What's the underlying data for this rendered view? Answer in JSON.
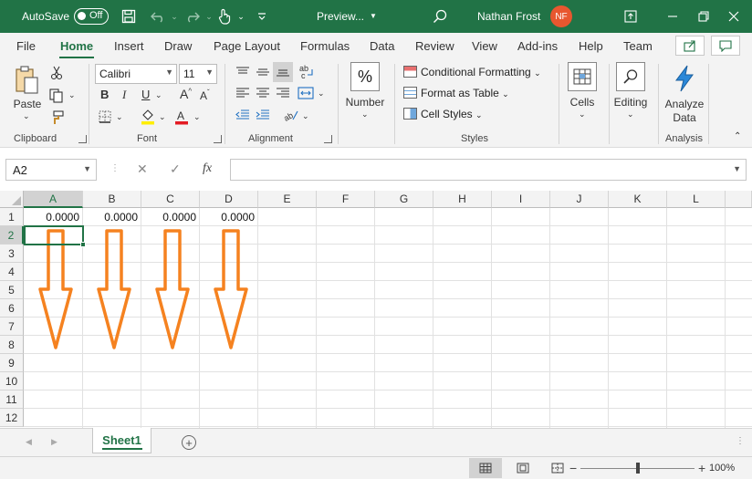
{
  "titlebar": {
    "autosave_label": "AutoSave",
    "autosave_state": "Off",
    "doc_title": "Preview...",
    "user_name": "Nathan Frost",
    "user_initials": "NF",
    "icons": [
      "save-icon",
      "undo-icon",
      "redo-icon",
      "touch-mode-icon",
      "customize-qat-icon",
      "search-icon",
      "ribbon-display-icon",
      "minimize-icon",
      "restore-icon",
      "close-icon"
    ]
  },
  "tabs": [
    "File",
    "Home",
    "Insert",
    "Draw",
    "Page Layout",
    "Formulas",
    "Data",
    "Review",
    "View",
    "Add-ins",
    "Help",
    "Team"
  ],
  "active_tab": "Home",
  "ribbon": {
    "clipboard": {
      "label": "Clipboard",
      "paste_label": "Paste"
    },
    "font": {
      "label": "Font",
      "font_name": "Calibri",
      "font_size": "11",
      "bold": "B",
      "italic": "I",
      "underline": "U"
    },
    "alignment": {
      "label": "Alignment"
    },
    "number": {
      "label": "Number",
      "symbol": "%"
    },
    "styles": {
      "label": "Styles",
      "conditional_formatting": "Conditional Formatting",
      "format_as_table": "Format as Table",
      "cell_styles": "Cell Styles"
    },
    "cells": {
      "label": "Cells"
    },
    "editing": {
      "label": "Editing"
    },
    "analysis": {
      "label": "Analysis",
      "analyze_data": "Analyze Data"
    }
  },
  "formula_bar": {
    "name_box": "A2",
    "fx": "fx",
    "formula": ""
  },
  "grid": {
    "columns": [
      "A",
      "B",
      "C",
      "D",
      "E",
      "F",
      "G",
      "H",
      "I",
      "J",
      "K",
      "L"
    ],
    "rows": [
      "1",
      "2",
      "3",
      "4",
      "5",
      "6",
      "7",
      "8",
      "9",
      "10",
      "11",
      "12"
    ],
    "row1_values": [
      "0.0000",
      "0.0000",
      "0.0000",
      "0.0000"
    ],
    "selected_column": "A",
    "selected_row": "2",
    "annotation_color": "#f58220"
  },
  "sheets": [
    "Sheet1"
  ],
  "status": {
    "zoom": "100%"
  },
  "colors": {
    "brand": "#217346",
    "avatar": "#e8572f",
    "arrow": "#f58220"
  }
}
